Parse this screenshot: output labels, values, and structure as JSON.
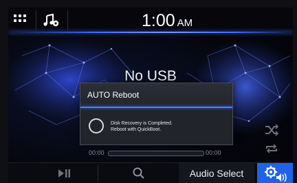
{
  "header": {
    "time": "1:00",
    "ampm": "AM",
    "menu_icon": "grid-icon",
    "source_icon": "music-settings-icon"
  },
  "main": {
    "status": "No USB",
    "shuffle_icon": "shuffle-icon",
    "repeat_icon": "repeat-icon"
  },
  "dialog": {
    "title": "AUTO Reboot",
    "message_line1": "Disk Recovery is Completed.",
    "message_line2": "Reboot with QuickBoot.",
    "spinner_icon": "progress-circle-icon"
  },
  "progress": {
    "elapsed": "00:00",
    "total": "00:00",
    "fraction": 0
  },
  "bottom": {
    "play_pause_icon": "play-pause-icon",
    "search_icon": "search-icon",
    "audio_select": "Audio Select",
    "settings_icon": "audio-settings-icon"
  },
  "colors": {
    "accent": "#1f63e8",
    "highlight_line": "#4d7dff",
    "background": "#05060d"
  }
}
